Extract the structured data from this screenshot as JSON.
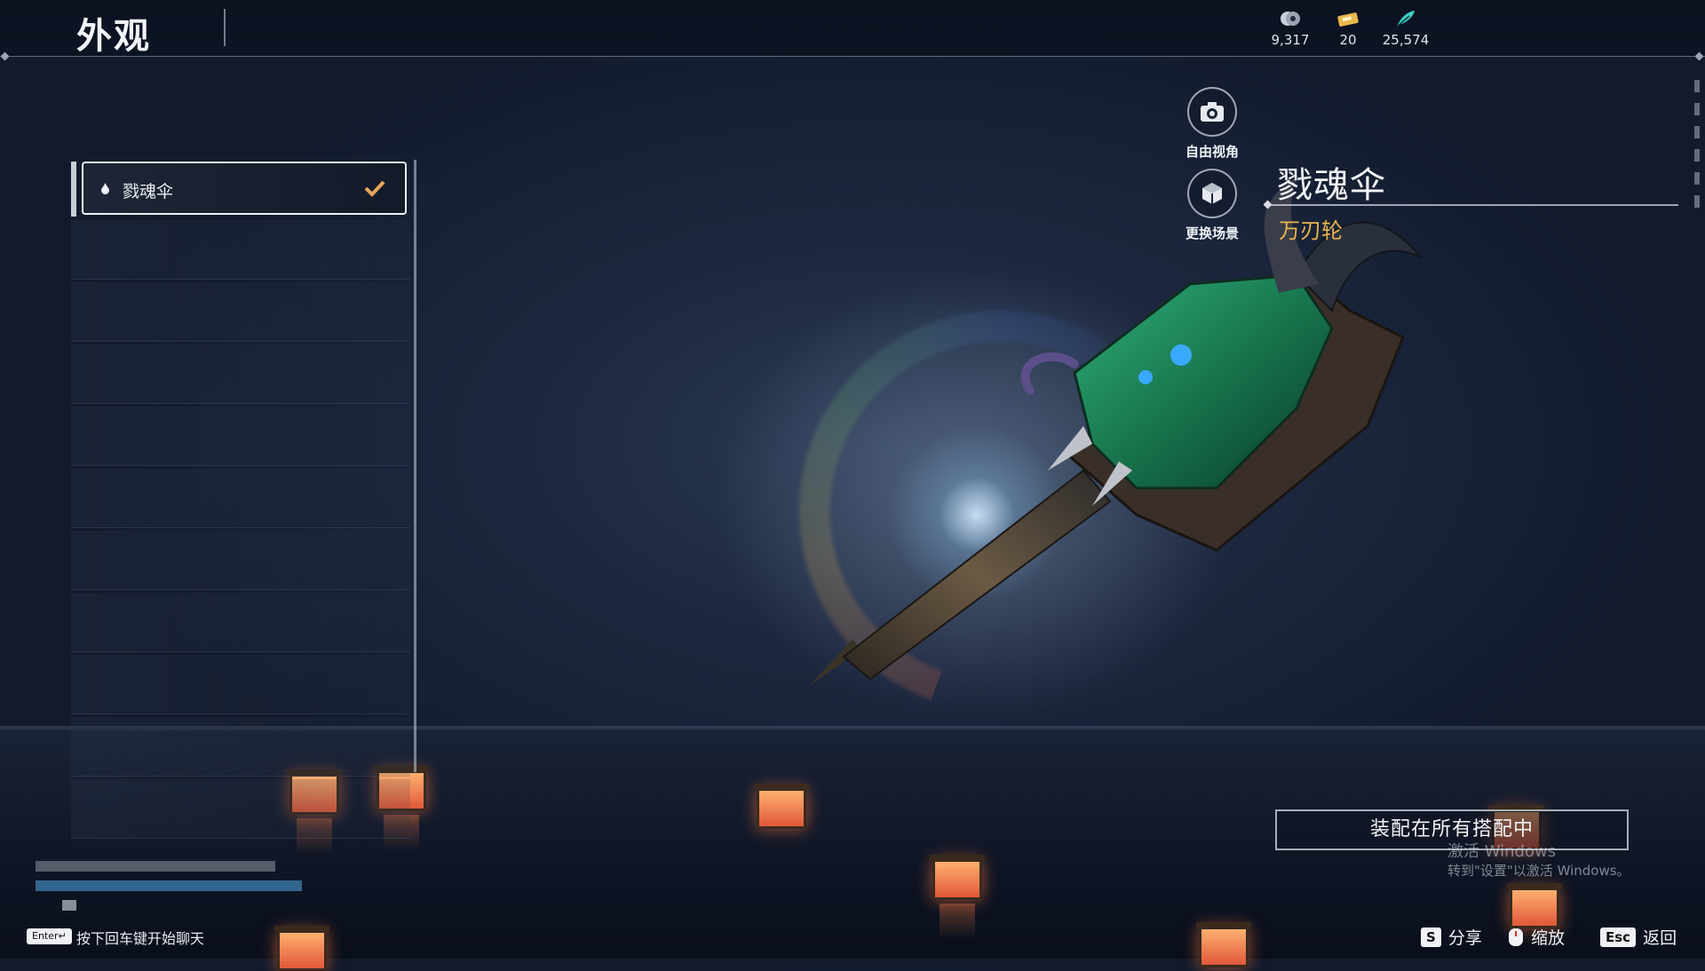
{
  "header": {
    "title": "外观",
    "currencies": [
      {
        "icon": "silver-coin-icon",
        "value": "9,317"
      },
      {
        "icon": "gold-ticket-icon",
        "value": "20"
      },
      {
        "icon": "feather-icon",
        "value": "25,574"
      }
    ]
  },
  "list": {
    "selected_item": {
      "label": "戮魂伞",
      "icon": "drop-icon",
      "checked": true
    }
  },
  "actions": {
    "free_camera": "自由视角",
    "change_scene": "更换场景"
  },
  "item": {
    "name": "戮魂伞",
    "subtitle": "万刃轮"
  },
  "equip": {
    "label": "装配在所有搭配中"
  },
  "watermark": {
    "line1": "激活 Windows",
    "line2": "转到\"设置\"以激活 Windows。"
  },
  "footer": {
    "enter_key": "Enter↵",
    "chat_hint": "按下回车键开始聊天",
    "hints": [
      {
        "key": "S",
        "label": "分享"
      },
      {
        "key": "mouse-icon",
        "label": "缩放"
      },
      {
        "key": "Esc",
        "label": "返回"
      }
    ]
  },
  "colors": {
    "accent": "#e8b64c",
    "background": "#1d2840"
  }
}
